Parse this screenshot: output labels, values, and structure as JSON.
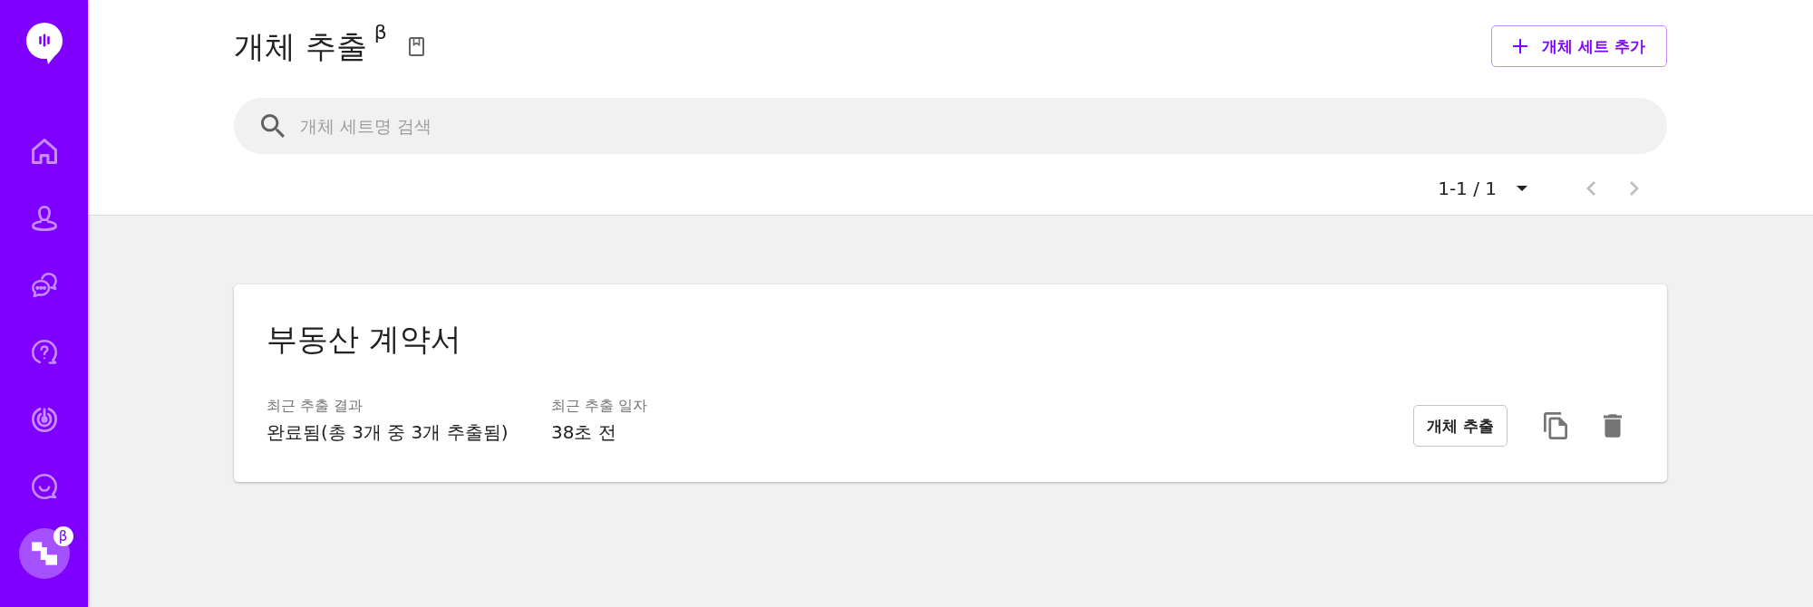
{
  "sidebar": {
    "items": [
      {
        "selected": false
      },
      {
        "selected": false
      },
      {
        "selected": false
      },
      {
        "selected": false
      },
      {
        "selected": false
      },
      {
        "selected": false
      },
      {
        "selected": true,
        "badge": "β"
      }
    ]
  },
  "header": {
    "title": "개체 추출",
    "title_badge": "β",
    "add_button": {
      "label": "개체 세트 추가"
    }
  },
  "search": {
    "placeholder": "개체 세트명 검색"
  },
  "pagination": {
    "range": "1-1 / 1",
    "prev_disabled": true,
    "next_disabled": true
  },
  "cards": [
    {
      "title": "부동산 계약서",
      "fields": [
        {
          "label": "최근 추출 결과",
          "value": "완료됨(총 3개 중 3개 추출됨)"
        },
        {
          "label": "최근 추출 일자",
          "value": "38초 전"
        }
      ],
      "extract_button": "개체 추출"
    }
  ]
}
